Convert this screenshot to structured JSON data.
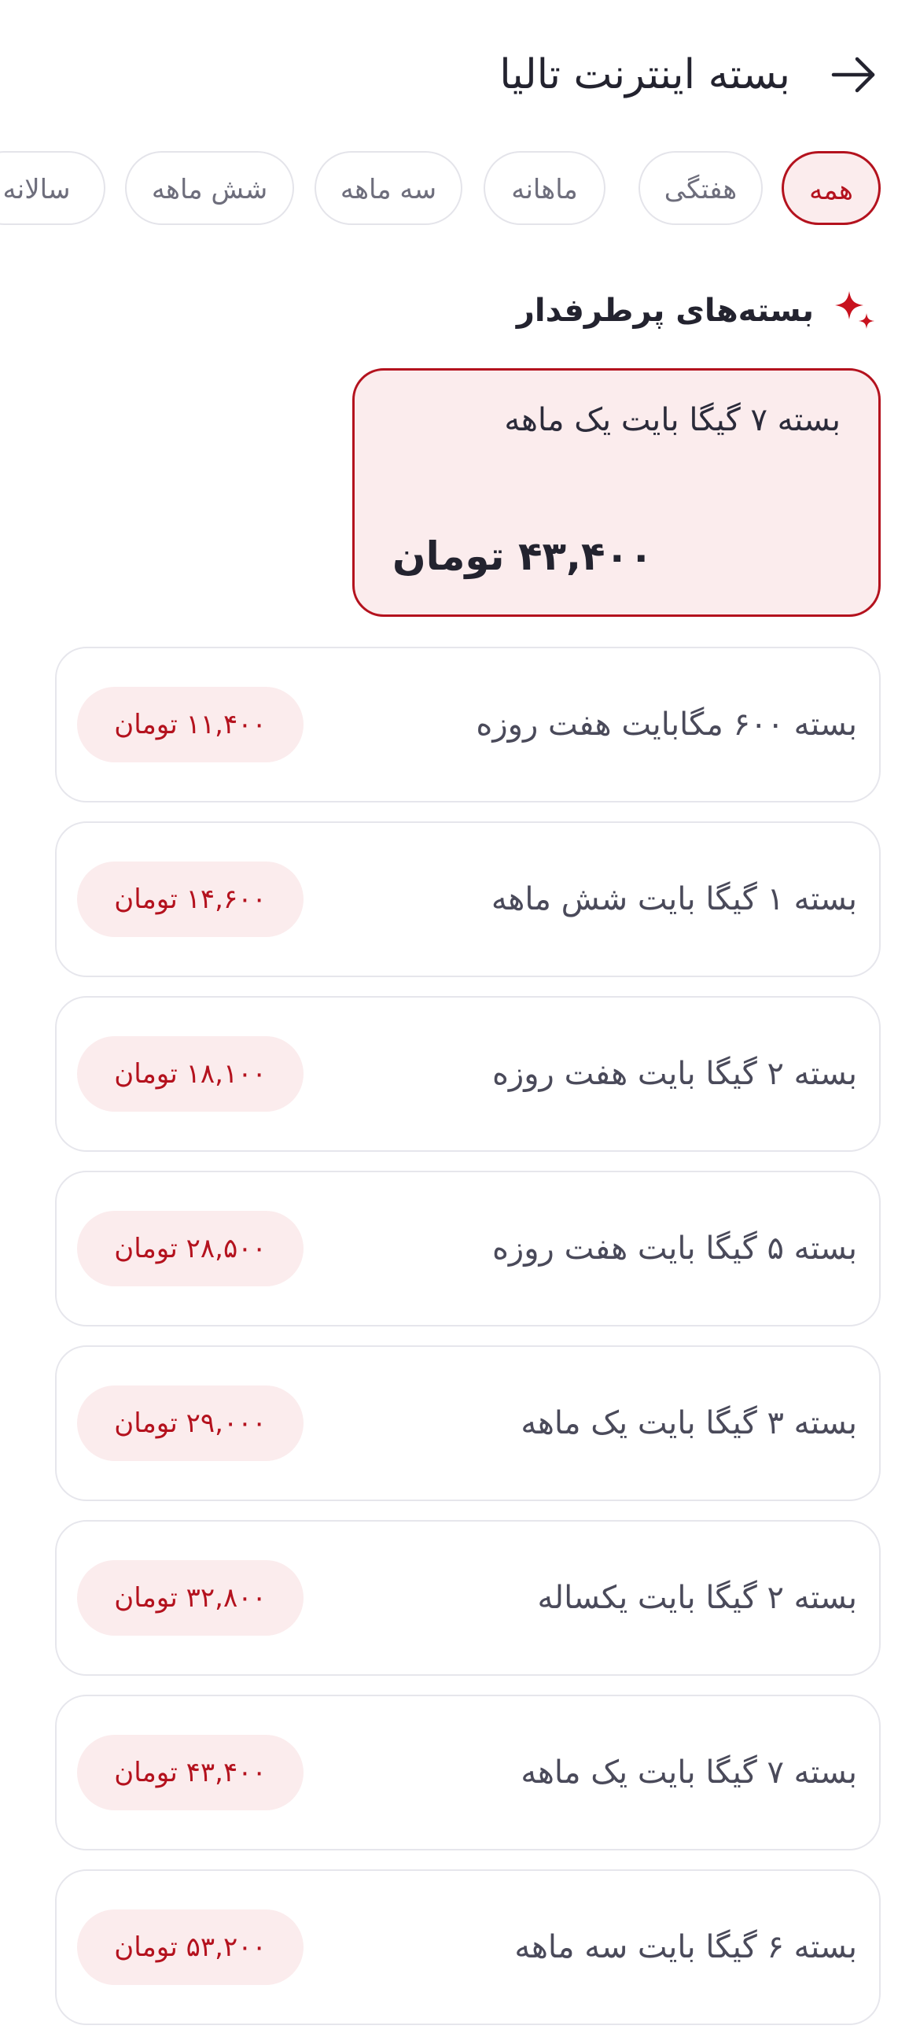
{
  "header": {
    "title": "بسته اینترنت تالیا",
    "back_icon": "arrow-right-icon"
  },
  "tabs": [
    {
      "label": "همه",
      "active": true
    },
    {
      "label": "هفتگی",
      "active": false
    },
    {
      "label": "ماهانه",
      "active": false
    },
    {
      "label": "سه ماهه",
      "active": false
    },
    {
      "label": "شش ماهه",
      "active": false
    },
    {
      "label": "سالانه",
      "active": false
    }
  ],
  "popular": {
    "title": "بسته‌های پرطرفدار",
    "icon": "sparkle-icon",
    "featured": {
      "name": "بسته ۷ گیگا بایت یک ماهه",
      "price": "۴۳,۴۰۰ تومان"
    }
  },
  "packages": [
    {
      "name": "بسته ۶۰۰ مگابایت هفت روزه",
      "price": "۱۱,۴۰۰ تومان"
    },
    {
      "name": "بسته ۱ گیگا بایت شش ماهه",
      "price": "۱۴,۶۰۰ تومان"
    },
    {
      "name": "بسته ۲ گیگا بایت هفت روزه",
      "price": "۱۸,۱۰۰ تومان"
    },
    {
      "name": "بسته ۵ گیگا بایت هفت روزه",
      "price": "۲۸,۵۰۰ تومان"
    },
    {
      "name": "بسته ۳ گیگا بایت یک ماهه",
      "price": "۲۹,۰۰۰ تومان"
    },
    {
      "name": "بسته ۲ گیگا بایت یکساله",
      "price": "۳۲,۸۰۰ تومان"
    },
    {
      "name": "بسته ۷ گیگا بایت یک ماهه",
      "price": "۴۳,۴۰۰ تومان"
    },
    {
      "name": "بسته ۶ گیگا بایت سه ماهه",
      "price": "۵۳,۲۰۰ تومان"
    }
  ],
  "colors": {
    "accent": "#b4121e",
    "accent_soft": "#fbeced",
    "border": "#e6e6ec",
    "text": "#23232f"
  }
}
